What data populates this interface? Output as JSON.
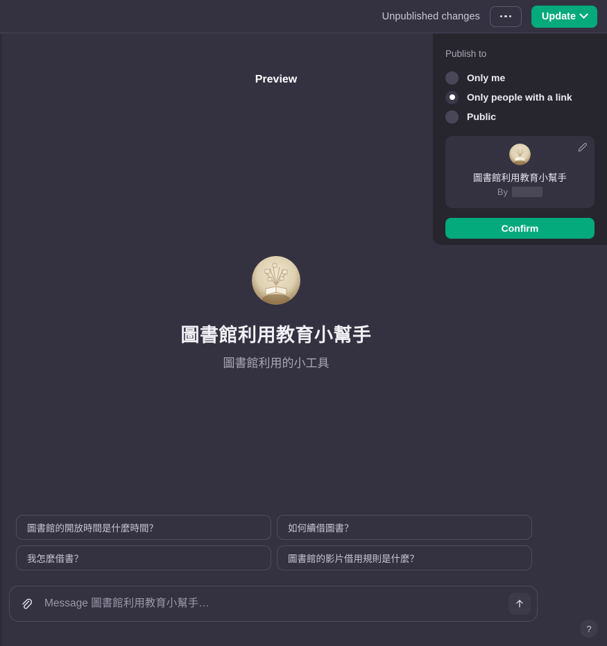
{
  "topbar": {
    "unpublished_label": "Unpublished changes",
    "more_button": "...",
    "update_label": "Update"
  },
  "publish_panel": {
    "title": "Publish to",
    "options": [
      {
        "label": "Only me",
        "selected": false
      },
      {
        "label": "Only people with a link",
        "selected": true
      },
      {
        "label": "Public",
        "selected": false
      }
    ],
    "agent_card": {
      "name": "圖書館利用教育小幫手",
      "by_label": "By",
      "by_value": "",
      "edit_icon": "pencil-icon"
    },
    "confirm_label": "Confirm"
  },
  "preview": {
    "heading": "Preview",
    "agent_title": "圖書館利用教育小幫手",
    "agent_subtitle": "圖書館利用的小工具"
  },
  "suggestions": [
    "圖書館的開放時間是什麼時間？",
    "如何續借圖書？",
    "我怎麼借書？",
    "圖書館的影片借用規則是什麼？"
  ],
  "composer": {
    "attach_icon": "paperclip-icon",
    "placeholder": "Message 圖書館利用教育小幫手…",
    "value": "",
    "send_icon": "arrow-up-icon"
  },
  "help": {
    "label": "?"
  },
  "colors": {
    "background": "#343241",
    "panel": "#27262f",
    "accent_green": "#04a97c",
    "border": "#4d4b5d",
    "text_primary": "#f2f1f6",
    "text_muted": "#a9a7b6"
  }
}
